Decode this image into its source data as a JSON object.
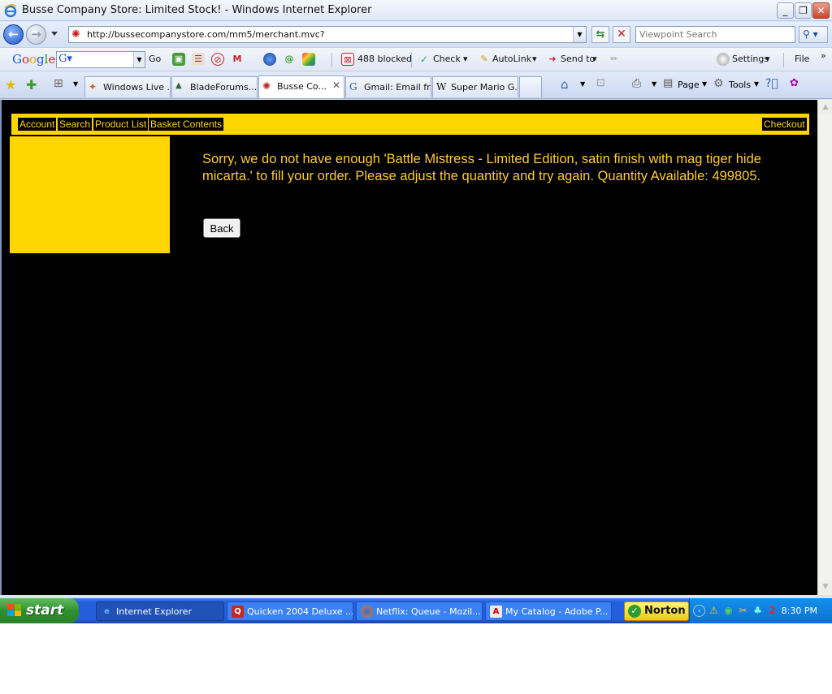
{
  "window": {
    "title": "Busse Company Store: Limited Stock! - Windows Internet Explorer",
    "minimize": "_",
    "restore": "❐",
    "close": "✕"
  },
  "address": {
    "url": "http://bussecompanystore.com/mm5/merchant.mvc?",
    "search_placeholder": "Viewpoint Search"
  },
  "google_toolbar": {
    "logo_text": "Google",
    "go_label": "Go",
    "blocked_label": "488 blocked",
    "check_label": "Check",
    "autolink_label": "AutoLink",
    "sendto_label": "Send to",
    "settings_label": "Settings",
    "file_label": "File"
  },
  "tabs": [
    {
      "label": "Windows Live ..."
    },
    {
      "label": "BladeForums...."
    },
    {
      "label": "Busse Co..."
    },
    {
      "label": "Gmail: Email fr..."
    },
    {
      "label": "Super Mario G..."
    }
  ],
  "command_bar": {
    "page_label": "Page",
    "tools_label": "Tools"
  },
  "store": {
    "nav": {
      "account": "Account",
      "search": "Search",
      "product_list": "Product List",
      "basket_contents": "Basket Contents",
      "checkout": "Checkout"
    },
    "message": "Sorry, we do not have enough 'Battle Mistress - Limited Edition, satin finish with mag tiger hide micarta.' to fill your order. Please adjust the quantity and try again. Quantity Available: 499805.",
    "back_label": "Back",
    "colors": {
      "accent": "#ffd500",
      "background": "#000000",
      "message": "#ffcc33"
    }
  },
  "taskbar": {
    "start_label": "start",
    "tasks": [
      {
        "label": "Internet Explorer"
      },
      {
        "label": "Quicken 2004 Deluxe ..."
      },
      {
        "label": "Netflix: Queue - Mozil..."
      },
      {
        "label": "My Catalog - Adobe P..."
      }
    ],
    "norton_label": "Norton",
    "clock": "8:30 PM"
  }
}
